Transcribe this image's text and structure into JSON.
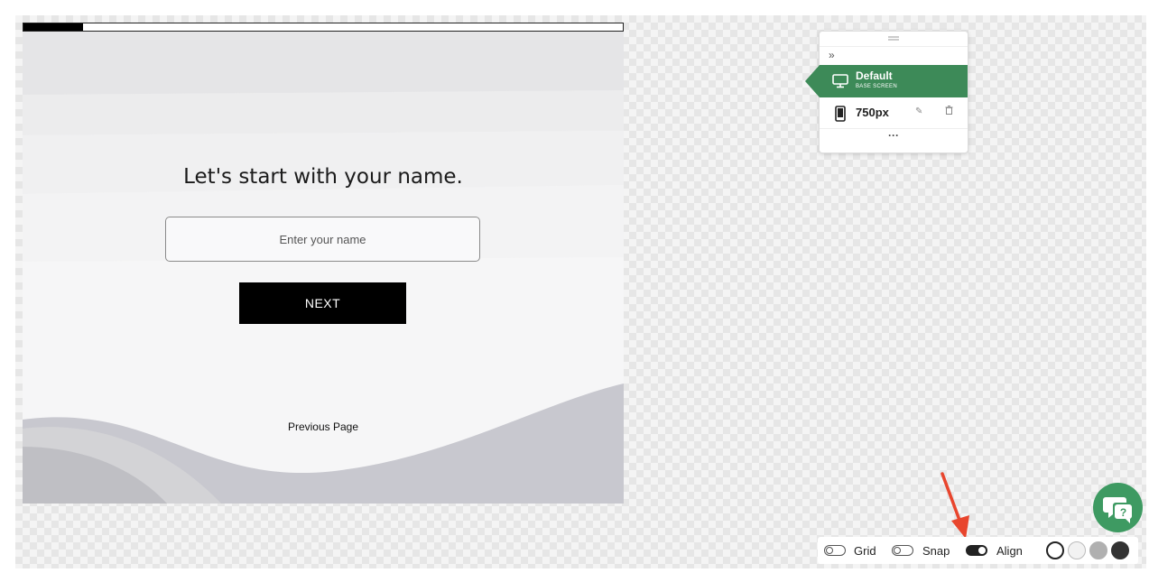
{
  "preview": {
    "progress": 0.1,
    "headline": "Let's start with your name.",
    "name_placeholder": "Enter your name",
    "next_label": "NEXT",
    "previous_label": "Previous Page"
  },
  "screens_panel": {
    "expand_icon": "»",
    "default": {
      "title": "Default",
      "subtitle": "BASE SCREEN"
    },
    "breakpoint": {
      "label": "750px"
    },
    "more": "···"
  },
  "toolbar": {
    "grid_label": "Grid",
    "grid_on": false,
    "snap_label": "Snap",
    "snap_on": false,
    "align_label": "Align",
    "align_on": true,
    "swatches": [
      "#ffffff",
      "#f2f2f2",
      "#b0b0b0",
      "#333333"
    ]
  },
  "colors": {
    "accent_green": "#3d8a58",
    "chat_green": "#3e9a62",
    "arrow_red": "#e8452d"
  }
}
